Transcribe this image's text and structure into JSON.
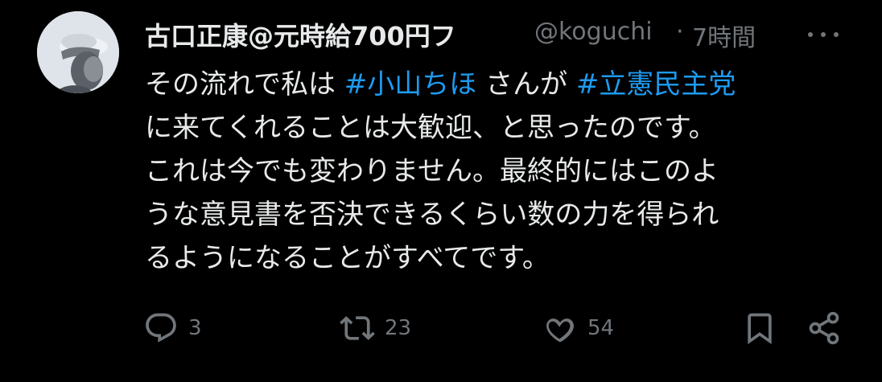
{
  "tweet": {
    "display_name": "古口正康@元時給700円フ",
    "handle": "@koguchi",
    "separator": "·",
    "time": "7時間",
    "text_lines": [
      [
        {
          "text": "その流れで私は ",
          "type": "text"
        },
        {
          "text": "#小山ちほ",
          "type": "hashtag"
        },
        {
          "text": " さんが ",
          "type": "text"
        },
        {
          "text": "#立憲民主党",
          "type": "hashtag"
        }
      ],
      [
        {
          "text": "に来てくれることは大歓迎、と思ったのです。",
          "type": "text"
        }
      ],
      [
        {
          "text": "これは今でも変わりません。最終的にはこのよ",
          "type": "text"
        }
      ],
      [
        {
          "text": "うな意見書を否決できるくらい数の力を得られ",
          "type": "text"
        }
      ],
      [
        {
          "text": "るようになることがすべてです。",
          "type": "text"
        }
      ]
    ],
    "actions": {
      "reply_count": "3",
      "retweet_count": "23",
      "like_count": "54"
    },
    "colors": {
      "background": "#000000",
      "text": "#e7e9ea",
      "muted": "#71767b",
      "hashtag": "#1d9bf0"
    },
    "icons": {
      "reply": "reply-icon",
      "retweet": "retweet-icon",
      "like": "heart-icon",
      "bookmark": "bookmark-icon",
      "share": "share-icon",
      "more": "more-icon"
    }
  }
}
